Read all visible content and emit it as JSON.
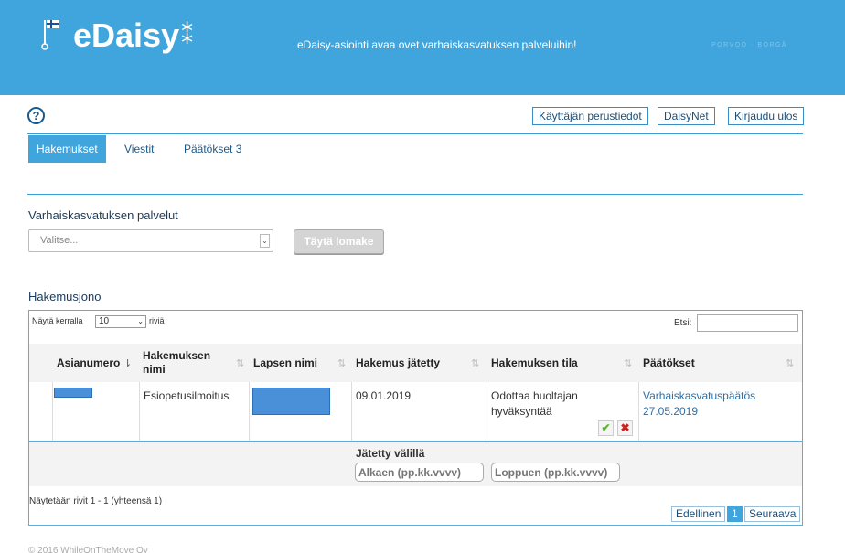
{
  "header": {
    "logo_text": "eDaisy",
    "slogan": "eDaisy-asiointi avaa ovet varhaiskasvatuksen palveluihin!",
    "city": "PORVOO · BORGÅ"
  },
  "help_icon": "question-icon",
  "top_buttons": {
    "profile": "Käyttäjän perustiedot",
    "daisynet": "DaisyNet",
    "logout": "Kirjaudu ulos"
  },
  "tabs": [
    {
      "label": "Hakemukset"
    },
    {
      "label": "Viestit"
    },
    {
      "label": "Päätökset 3"
    }
  ],
  "services": {
    "title": "Varhaiskasvatuksen palvelut",
    "select_value": "Valitse...",
    "fill_button": "Täytä lomake"
  },
  "queue": {
    "title": "Hakemusjono",
    "length_label": "Näytä kerralla",
    "length_value": "10",
    "length_suffix": "riviä",
    "search_label": "Etsi:",
    "columns": [
      "Asianumero",
      "Hakemuksen nimi",
      "Lapsen nimi",
      "Hakemus jätetty",
      "Hakemuksen tila",
      "Päätökset"
    ],
    "row": {
      "name": "Esiopetusilmoitus",
      "submitted": "09.01.2019",
      "status": "Odottaa huoltajan hyväksyntää",
      "decision": "Varhaiskasvatuspäätös 27.05.2019"
    },
    "filter": {
      "label": "Jätetty välillä",
      "from_placeholder": "Alkaen (pp.kk.vvvv)",
      "to_placeholder": "Loppuen (pp.kk.vvvv)"
    },
    "info": "Näytetään rivit 1 - 1 (yhteensä 1)",
    "pager": {
      "prev": "Edellinen",
      "current": "1",
      "next": "Seuraava"
    }
  },
  "footer": "© 2016 WhileOnTheMove Oy",
  "colors": {
    "brand": "#41a5dd",
    "accent": "#1a5a8c"
  }
}
